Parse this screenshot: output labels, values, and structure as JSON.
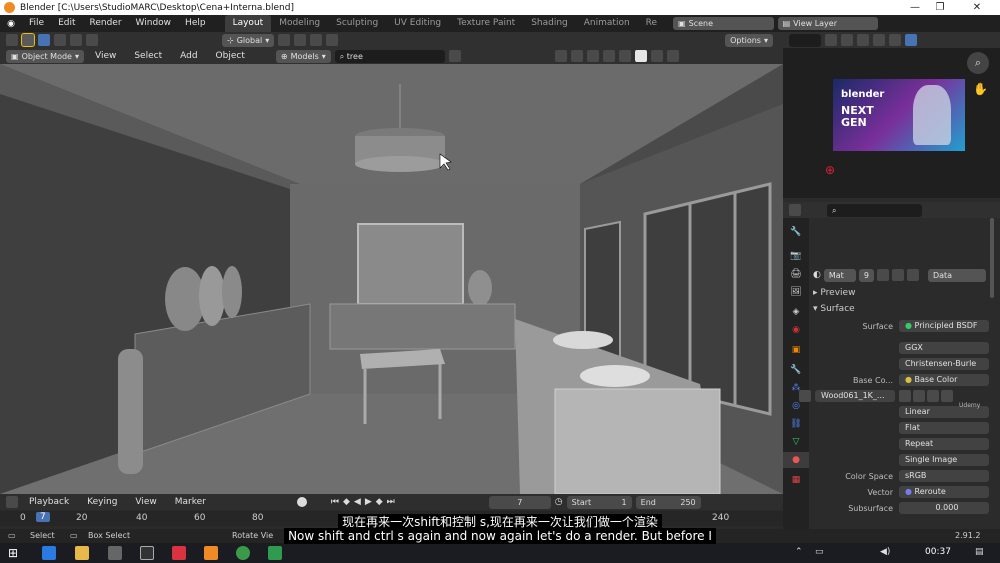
{
  "window": {
    "title": "Blender [C:\\Users\\StudioMARC\\Desktop\\Cena+Interna.blend]",
    "minimize": "—",
    "maximize": "❐",
    "close": "✕"
  },
  "menu": [
    "File",
    "Edit",
    "Render",
    "Window",
    "Help"
  ],
  "workspaces": [
    "Layout",
    "Modeling",
    "Sculpting",
    "UV Editing",
    "Texture Paint",
    "Shading",
    "Animation",
    "Re"
  ],
  "active_workspace": "Layout",
  "scene": {
    "label": "Scene",
    "view_layer": "View Layer"
  },
  "toolbar": {
    "orientation": "Global",
    "options": "Options"
  },
  "viewport_header": {
    "mode": "Object Mode",
    "view": "View",
    "select": "Select",
    "add": "Add",
    "object": "Object",
    "models": "Models",
    "search_value": "tree"
  },
  "timeline": {
    "playback": "Playback",
    "keying": "Keying",
    "view": "View",
    "marker": "Marker",
    "current_frame": "7",
    "start_label": "Start",
    "start": "1",
    "end_label": "End",
    "end": "250",
    "ruler": [
      "0",
      "7",
      "20",
      "40",
      "60",
      "80",
      "240"
    ]
  },
  "status": {
    "select": "Select",
    "box_select": "Box Select",
    "rotate": "Rotate Vie",
    "version": "2.91.2"
  },
  "properties": {
    "material_name": "Mat",
    "user_count": "9",
    "data_label": "Data",
    "preview": "Preview",
    "surface_panel": "Surface",
    "rows": [
      {
        "label": "Surface",
        "value": "Principled BSDF"
      },
      {
        "label": "",
        "value": "GGX"
      },
      {
        "label": "",
        "value": "Christensen-Burle"
      },
      {
        "label": "Base Co...",
        "value": "Base Color"
      },
      {
        "label": "",
        "value": "Wood061_1K_..."
      },
      {
        "label": "",
        "value": "Linear"
      },
      {
        "label": "",
        "value": "Flat"
      },
      {
        "label": "",
        "value": "Repeat"
      },
      {
        "label": "",
        "value": "Single Image"
      },
      {
        "label": "Color Space",
        "value": "sRGB"
      },
      {
        "label": "Vector",
        "value": "Reroute"
      },
      {
        "label": "Subsurface",
        "value": "0.000"
      }
    ]
  },
  "thumbnail": {
    "brand": "blender",
    "title": "NEXT GEN"
  },
  "watermark": "Udemy",
  "subtitles": {
    "zh": "现在再来一次shift和控制 s,现在再来一次让我们做一个渲染",
    "en": "Now shift and ctrl s again and now again let's do a render. But before I"
  },
  "taskbar": {
    "time": "00:37"
  },
  "colors": {
    "accent": "#4772b3",
    "header": "#303030",
    "panel": "#2b2b2b",
    "viewport": "#4a4a4a"
  }
}
